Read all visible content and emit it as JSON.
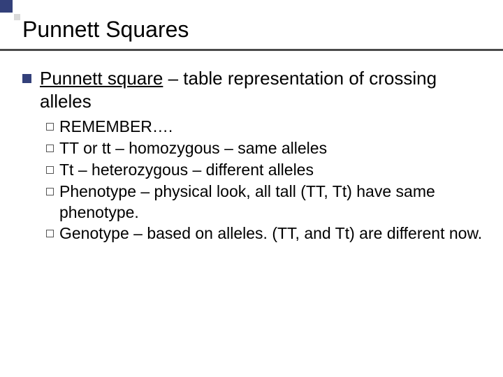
{
  "title": "Punnett Squares",
  "main": {
    "term": "Punnett square",
    "definition_rest": " – table representation of crossing alleles"
  },
  "subs": [
    {
      "lead": "REMEMBER….",
      "rest": ""
    },
    {
      "lead": "TT",
      "rest": " or tt – homozygous – same alleles"
    },
    {
      "lead": "Tt",
      "rest": " – heterozygous – different alleles"
    },
    {
      "lead": "Phenotype",
      "rest": " – physical look, all tall (TT, Tt) have same phenotype."
    },
    {
      "lead": "Genotype",
      "rest": " – based on alleles.  (TT, and Tt) are different now."
    }
  ]
}
